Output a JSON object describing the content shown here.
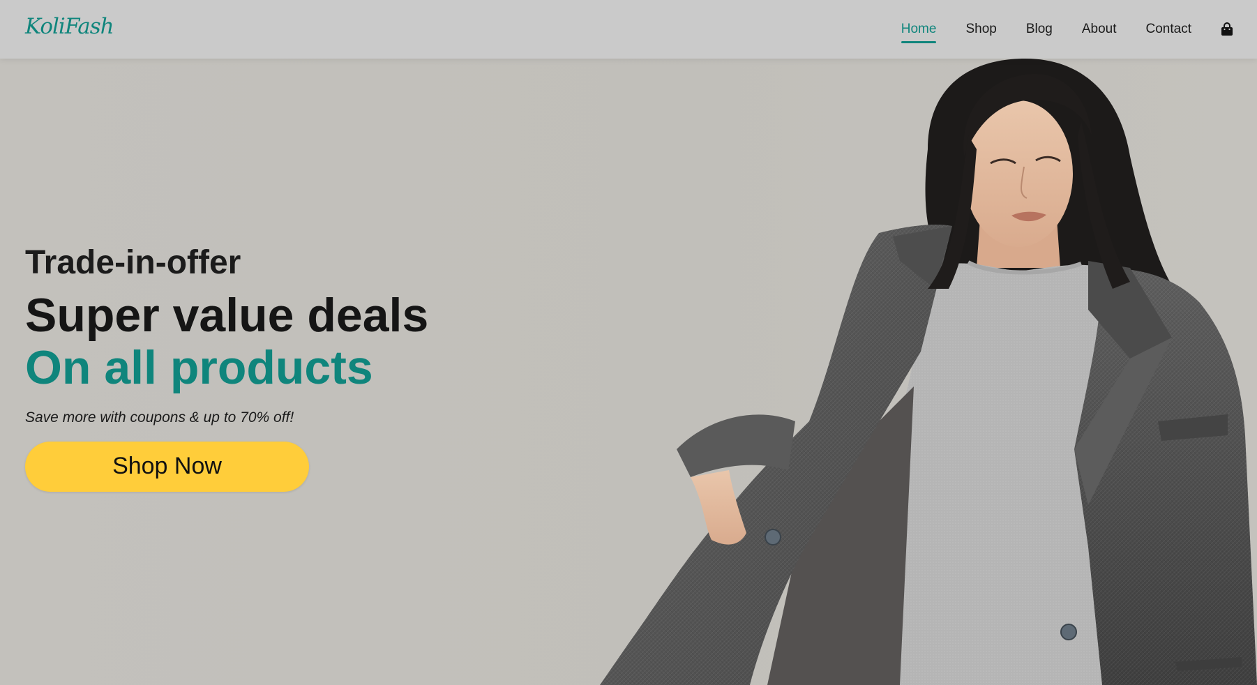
{
  "brand": {
    "logo_text": "KoliFash"
  },
  "nav": {
    "items": [
      {
        "label": "Home",
        "active": true
      },
      {
        "label": "Shop",
        "active": false
      },
      {
        "label": "Blog",
        "active": false
      },
      {
        "label": "About",
        "active": false
      },
      {
        "label": "Contact",
        "active": false
      }
    ],
    "cart_icon": "shopping-bag-icon"
  },
  "hero": {
    "eyebrow": "Trade-in-offer",
    "headline": "Super value deals",
    "headline_highlight": "On all products",
    "subtext": "Save more with coupons & up to 70% off!",
    "cta_label": "Shop Now"
  },
  "colors": {
    "accent": "#0f857c",
    "cta": "#ffcd3a",
    "header_bg": "#cacaca",
    "hero_bg": "#c2c0bb"
  }
}
